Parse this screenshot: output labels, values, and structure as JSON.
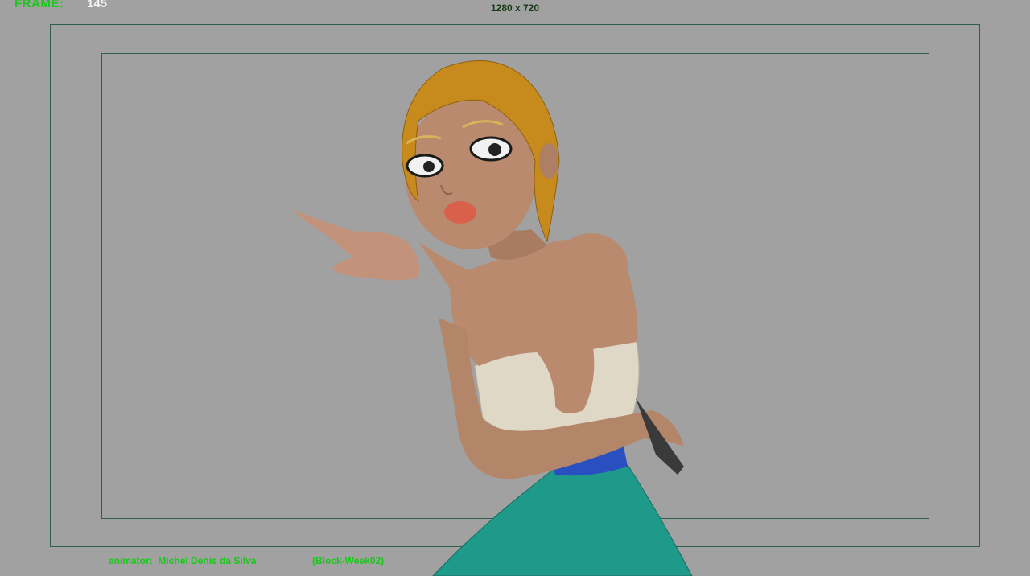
{
  "hud": {
    "frame_label": "FRAME:",
    "frame_value": "145",
    "resolution": "1280 x 720",
    "animator_label": "animator:",
    "animator_name": "Michel Denis da Silva",
    "note": "(Block-Week02)"
  },
  "colors": {
    "viewport_background": "#a1a1a1",
    "hud_green": "#19c819",
    "gate_line": "#2f5f4a",
    "skirt": "#1f9a8a",
    "waist_band": "#2a4fc0",
    "top_garment": "#e0d8c6",
    "hair": "#c78a1c",
    "skin": "#b98a6e"
  },
  "scene": {
    "subject_icon": "animated-character-icon"
  }
}
